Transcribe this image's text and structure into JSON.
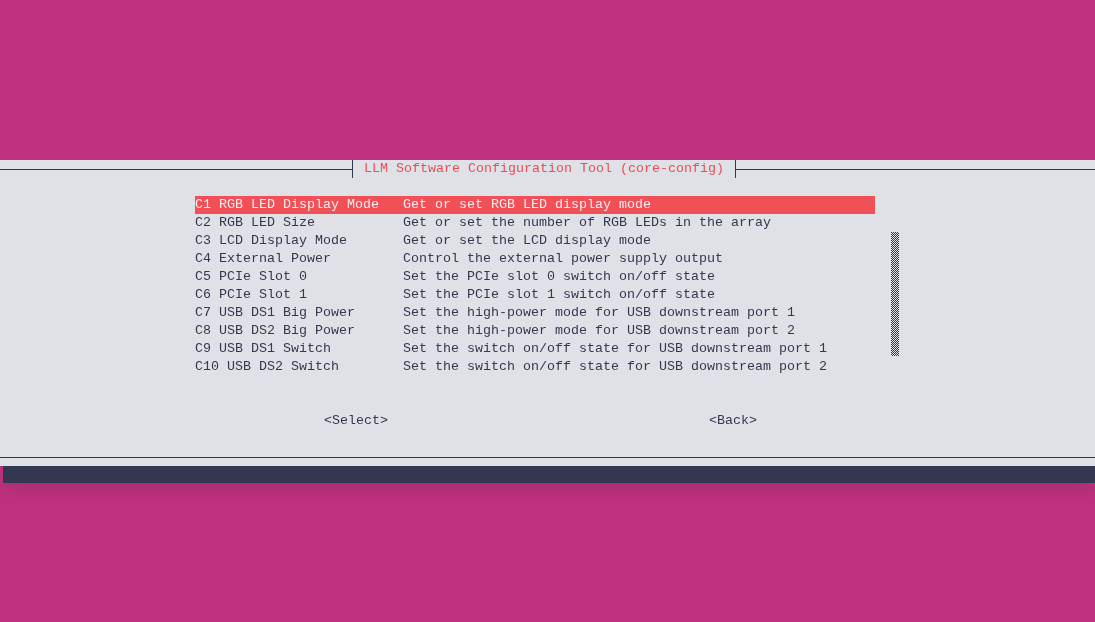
{
  "dialog": {
    "title": "LLM Software Configuration Tool (core-config)"
  },
  "menu": [
    {
      "code": "C1 RGB LED Display Mode",
      "description": "Get or set RGB LED display mode",
      "selected": true
    },
    {
      "code": "C2 RGB LED Size",
      "description": "Get or set the number of RGB LEDs in the array",
      "selected": false
    },
    {
      "code": "C3 LCD Display Mode",
      "description": "Get or set the LCD display mode",
      "selected": false
    },
    {
      "code": "C4 External Power",
      "description": "Control the external power supply output",
      "selected": false
    },
    {
      "code": "C5 PCIe Slot 0",
      "description": "Set the PCIe slot 0 switch on/off state",
      "selected": false
    },
    {
      "code": "C6 PCIe Slot 1",
      "description": "Set the PCIe slot 1 switch on/off state",
      "selected": false
    },
    {
      "code": "C7 USB DS1 Big Power",
      "description": "Set the high-power mode for USB downstream port 1",
      "selected": false
    },
    {
      "code": "C8 USB DS2 Big Power",
      "description": "Set the high-power mode for USB downstream port 2",
      "selected": false
    },
    {
      "code": "C9 USB DS1 Switch",
      "description": "Set the switch on/off state for USB downstream port 1",
      "selected": false
    },
    {
      "code": "C10 USB DS2 Switch",
      "description": "Set the switch on/off state for USB downstream port 2",
      "selected": false
    }
  ],
  "buttons": [
    "<Select>",
    "<Back>"
  ]
}
